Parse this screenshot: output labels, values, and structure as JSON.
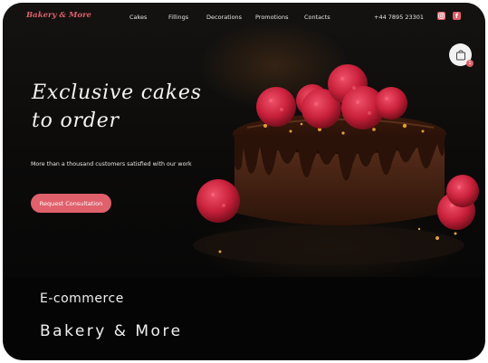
{
  "brand": {
    "logo": "Bakery & More"
  },
  "nav": {
    "items": [
      {
        "label": "Cakes"
      },
      {
        "label": "Fillings"
      },
      {
        "label": "Decorations"
      },
      {
        "label": "Promotions"
      },
      {
        "label": "Contacts"
      }
    ],
    "phone": "+44 7895 23301",
    "social": [
      {
        "icon": "instagram-icon"
      },
      {
        "icon": "facebook-icon"
      }
    ]
  },
  "cart": {
    "badge": "1",
    "icon": "shopping-bag-icon"
  },
  "hero": {
    "title_line1": "Exclusive cakes",
    "title_line2": "to order",
    "tagline": "More than a thousand customers satisfied with our work",
    "cta_label": "Request Consultation"
  },
  "footer": {
    "title": "E-commerce",
    "subtitle": "Bakery & More"
  },
  "colors": {
    "accent": "#e0606b",
    "background": "#050505",
    "text": "#f0f0f0"
  }
}
